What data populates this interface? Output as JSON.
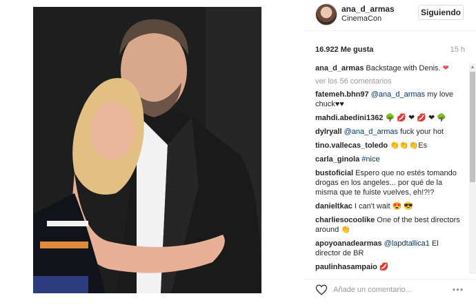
{
  "post": {
    "username": "ana_d_armas",
    "location": "CinemaCon",
    "follow_label": "Siguiendo",
    "likes": "16.922 Me gusta",
    "time": "15 h"
  },
  "caption": {
    "user": "ana_d_armas",
    "text": "Backstage with Denis.",
    "emoji": "heart-emoji"
  },
  "view_all": "ver los 56 comentarios",
  "comments": [
    {
      "user": "fatemeh.bhn97",
      "mention": "@ana_d_armas",
      "text": "my love chuck♥♥"
    },
    {
      "user": "mahdi.abedini1362",
      "text": "",
      "emojis": "🌳 💋 ❤ 💋 ❤ 🌳"
    },
    {
      "user": "dylryall",
      "mention": "@ana_d_armas",
      "text": "fuck your hot"
    },
    {
      "user": "tino.vallecas_toledo",
      "text": "👏👏👏Es"
    },
    {
      "user": "carla_ginola",
      "tag": "#nice",
      "text": ""
    },
    {
      "user": "bustoficial",
      "text": "Espero que no estés tomando drogas en los angeles... por qué de la misma que te fuiste vuelves, eh!?!?"
    },
    {
      "user": "danieltkac",
      "text": "I can't wait 😍 😎"
    },
    {
      "user": "charliesocoolike",
      "text": "One of the best directors around 👏"
    },
    {
      "user": "apoyoanadearmas",
      "mention": "@lapdtallica1",
      "text": "El director de BR"
    },
    {
      "user": "paulinhasampaio",
      "text": "💋"
    }
  ],
  "footer": {
    "placeholder": "Añade un comentario...",
    "more_icon": "ellipsis-icon"
  },
  "colors": {
    "link": "#003569",
    "muted": "#999999",
    "heart": "#ed4956"
  }
}
